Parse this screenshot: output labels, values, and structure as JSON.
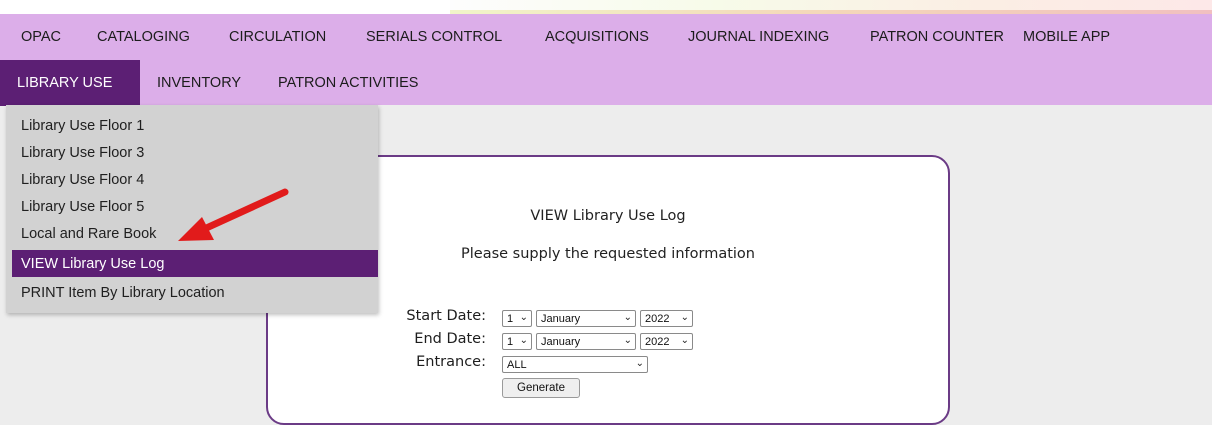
{
  "colors": {
    "menubar_bg": "#dcaee9",
    "active_bg": "#5c1f74",
    "dropdown_bg": "#d2d2d2",
    "panel_border": "#6b3b86",
    "arrow": "#e11b1b"
  },
  "menubar": {
    "row1": [
      "OPAC",
      "CATALOGING",
      "CIRCULATION",
      "SERIALS CONTROL",
      "ACQUISITIONS",
      "JOURNAL INDEXING",
      "PATRON COUNTER",
      "MOBILE APP"
    ],
    "row2": [
      "LIBRARY USE",
      "INVENTORY",
      "PATRON ACTIVITIES"
    ],
    "active": "LIBRARY USE"
  },
  "dropdown": {
    "items": [
      "Library Use Floor 1",
      "Library Use Floor 3",
      "Library Use Floor 4",
      "Library Use Floor 5",
      "Local and Rare Book",
      "VIEW Library Use Log",
      "PRINT Item By Library Location"
    ],
    "selected": "VIEW Library Use Log"
  },
  "panel": {
    "title": "VIEW Library Use Log",
    "subtitle": "Please supply the requested information"
  },
  "form": {
    "start_label": "Start Date:",
    "end_label": "End Date:",
    "entrance_label": "Entrance:",
    "start_day": "1",
    "start_month": "January",
    "start_year": "2022",
    "end_day": "1",
    "end_month": "January",
    "end_year": "2022",
    "entrance_value": "ALL",
    "generate_label": "Generate"
  },
  "icons": {
    "chevron": "chevron-down-icon",
    "annotation": "red-arrow-icon"
  }
}
